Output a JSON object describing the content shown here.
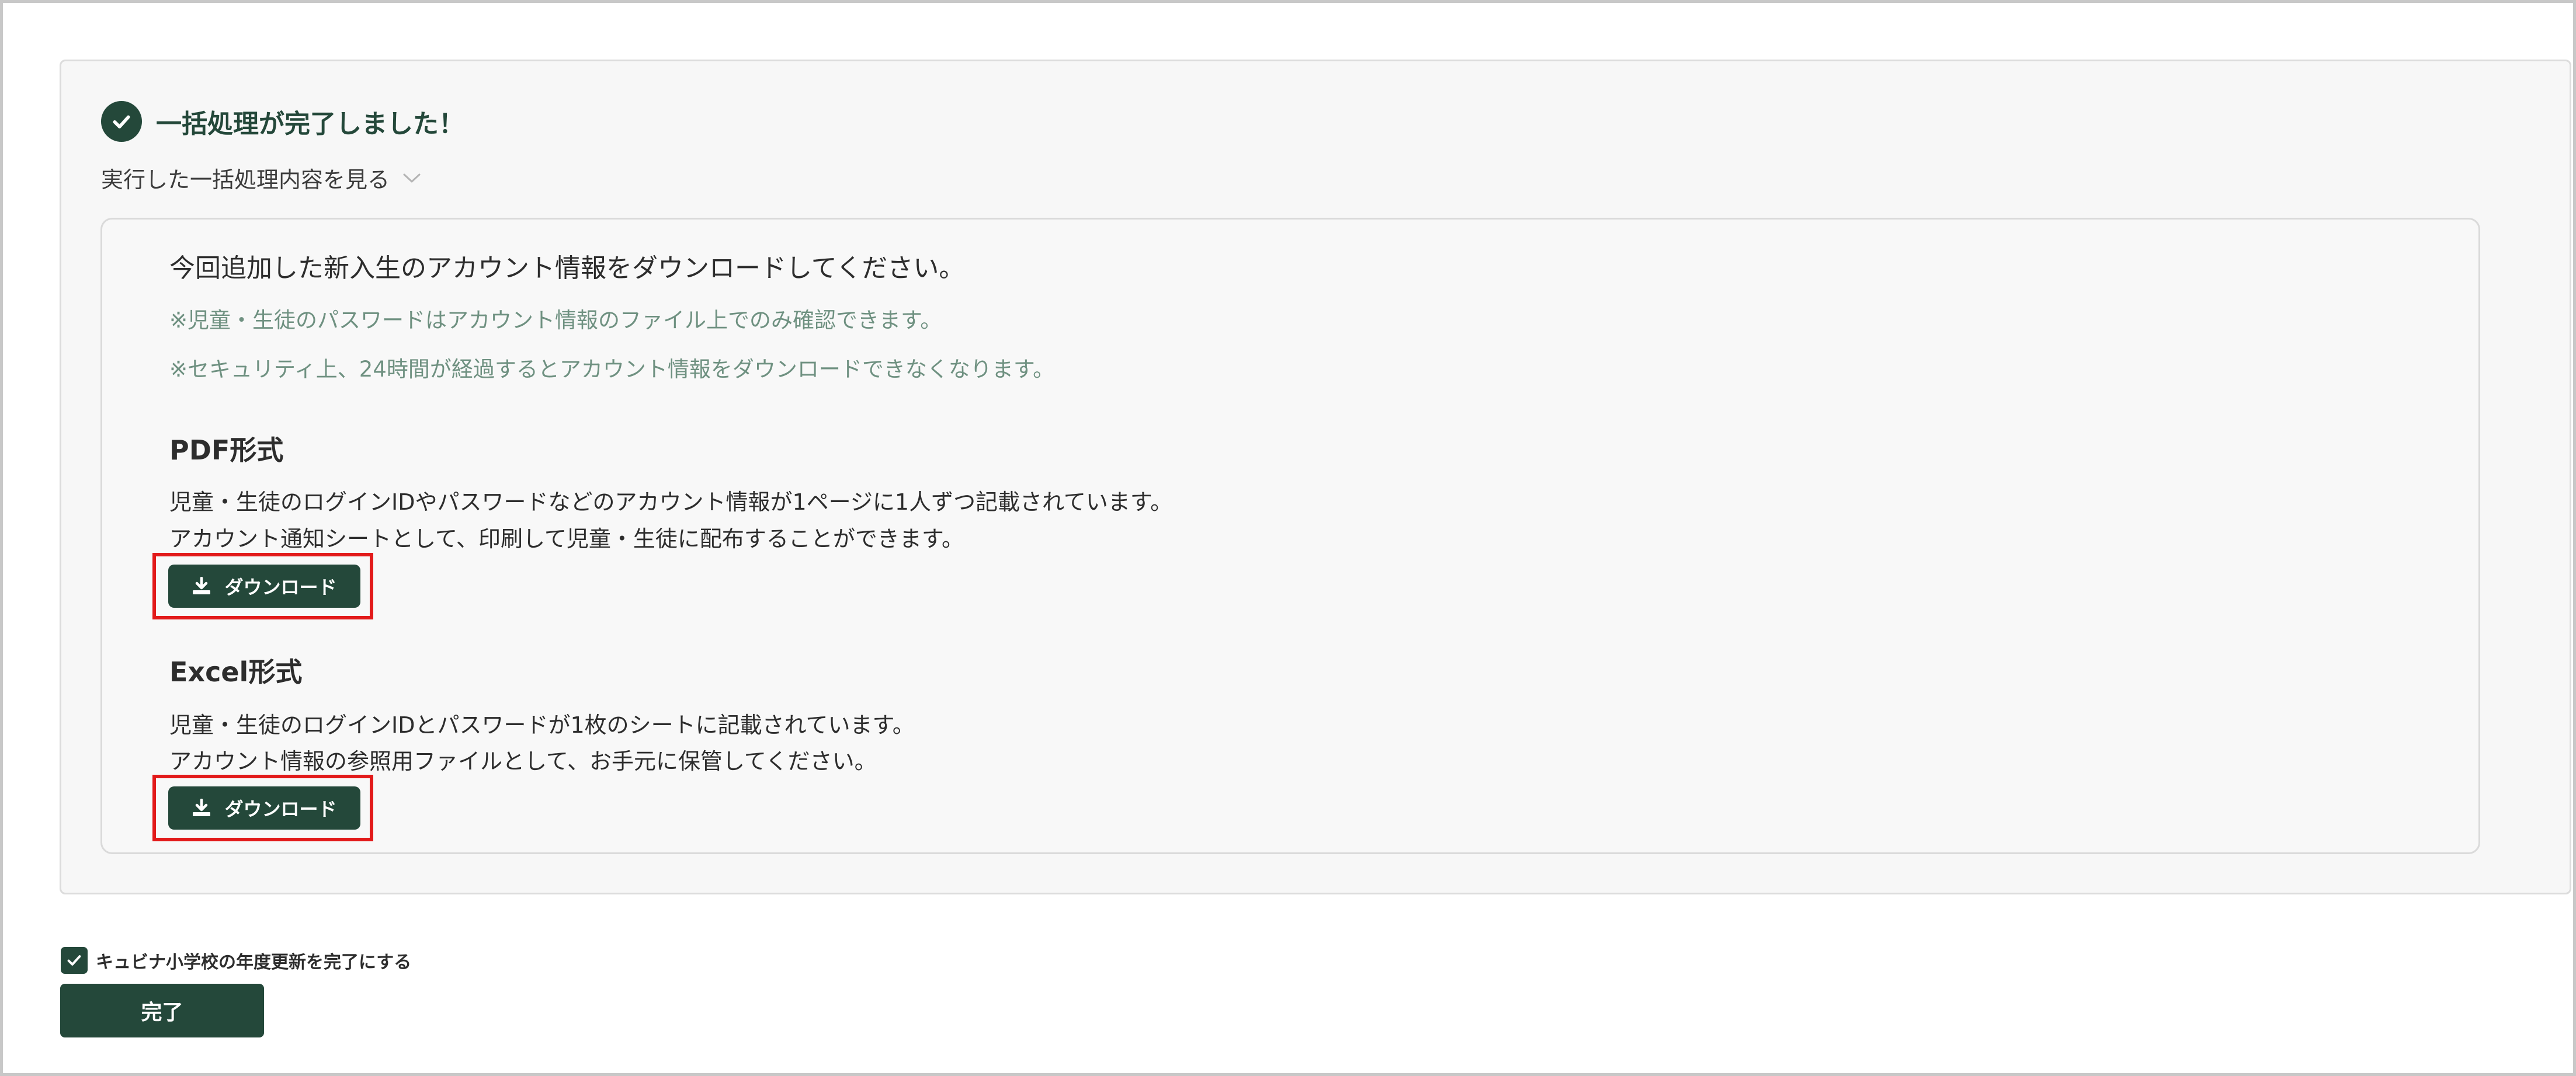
{
  "colors": {
    "brand_green": "#24483a",
    "note_text": "#6f9181",
    "highlight_red": "#e21a1a"
  },
  "header": {
    "icon": "check-circle-icon",
    "title": "一括処理が完了しました！",
    "details_toggle_label": "実行した一括処理内容を見る",
    "details_toggle_icon": "chevron-down-icon"
  },
  "download_panel": {
    "lead": "今回追加した新入生のアカウント情報をダウンロードしてください。",
    "notes": [
      "※児童・生徒のパスワードはアカウント情報のファイル上でのみ確認できます。",
      "※セキュリティ上、24時間が経過するとアカウント情報をダウンロードできなくなります。"
    ],
    "pdf": {
      "title": "PDF形式",
      "desc_line1": "児童・生徒のログインIDやパスワードなどのアカウント情報が1ページに1人ずつ記載されています。",
      "desc_line2": "アカウント通知シートとして、印刷して児童・生徒に配布することができます。",
      "button_label": "ダウンロード",
      "button_icon": "download-icon"
    },
    "excel": {
      "title": "Excel形式",
      "desc_line1": "児童・生徒のログインIDとパスワードが1枚のシートに記載されています。",
      "desc_line2": "アカウント情報の参照用ファイルとして、お手元に保管してください。",
      "button_label": "ダウンロード",
      "button_icon": "download-icon"
    }
  },
  "footer": {
    "checkbox_label": "キュビナ小学校の年度更新を完了にする",
    "checkbox_checked": true,
    "done_label": "完了"
  }
}
